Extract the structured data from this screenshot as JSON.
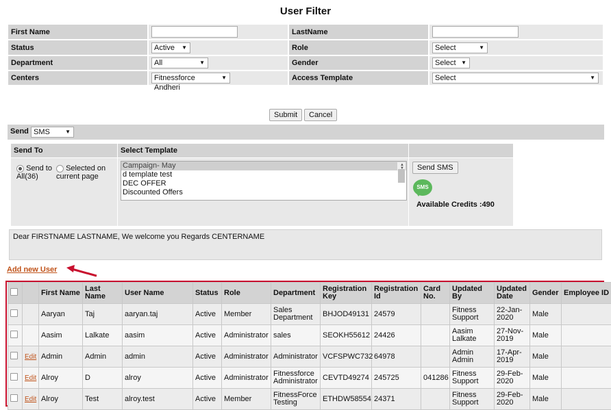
{
  "page_title": "User Filter",
  "filter": {
    "first_name_label": "First Name",
    "last_name_label": "LastName",
    "first_name_value": "",
    "last_name_value": "",
    "status_label": "Status",
    "status_value": "Active",
    "role_label": "Role",
    "role_value": "Select",
    "department_label": "Department",
    "department_value": "All",
    "gender_label": "Gender",
    "gender_value": "Select",
    "centers_label": "Centers",
    "centers_value": "Fitnessforce Andheri",
    "access_template_label": "Access Template",
    "access_template_value": "Select",
    "submit_label": "Submit",
    "cancel_label": "Cancel"
  },
  "send": {
    "label": "Send",
    "mode": "SMS",
    "send_to_header": "Send To",
    "select_template_header": "Select Template",
    "option_all": "Send to All(36)",
    "option_all_a": "Send to",
    "option_all_b": "All(36)",
    "option_page_a": "Selected on",
    "option_page_b": "current page",
    "templates": [
      "Campaign- May",
      "d template test",
      "DEC OFFER",
      "Discounted Offers"
    ],
    "send_sms_label": "Send SMS",
    "sms_icon_text": "SMS",
    "credits": "Available Credits :490",
    "message": "Dear FIRSTNAME LASTNAME, We welcome you Regards CENTERNAME"
  },
  "add_new_user_label": "Add new User",
  "table": {
    "headers": [
      "",
      "",
      "First Name",
      "Last Name",
      "User Name",
      "Status",
      "Role",
      "Department",
      "Registration Key",
      "Registration Id",
      "Card No.",
      "Updated By",
      "Updated Date",
      "Gender",
      "Employee ID"
    ],
    "edit_label": "Edit",
    "rows": [
      {
        "edit": false,
        "first": "Aaryan",
        "last": "Taj",
        "user": "aaryan.taj",
        "status": "Active",
        "role": "Member",
        "dept": "Sales Department",
        "key": "BHJOD49131",
        "regid": "24579",
        "card": "",
        "by": "Fitness Support",
        "date": "22-Jan-2020",
        "gender": "Male",
        "emp": ""
      },
      {
        "edit": false,
        "first": "Aasim",
        "last": "Lalkate",
        "user": "aasim",
        "status": "Active",
        "role": "Administrator",
        "dept": "sales",
        "key": "SEOKH55612",
        "regid": "24426",
        "card": "",
        "by": "Aasim Lalkate",
        "date": "27-Nov-2019",
        "gender": "Male",
        "emp": ""
      },
      {
        "edit": true,
        "first": "Admin",
        "last": "Admin",
        "user": "admin",
        "status": "Active",
        "role": "Administrator",
        "dept": "Administrator",
        "key": "VCFSPWC732",
        "regid": "64978",
        "card": "",
        "by": "Admin Admin",
        "date": "17-Apr-2019",
        "gender": "Male",
        "emp": ""
      },
      {
        "edit": true,
        "first": "Alroy",
        "last": "D",
        "user": "alroy",
        "status": "Active",
        "role": "Administrator",
        "dept": "Fitnessforce Administrator",
        "key": "CEVTD49274",
        "regid": "245725",
        "card": "041286",
        "by": "Fitness Support",
        "date": "29-Feb-2020",
        "gender": "Male",
        "emp": ""
      },
      {
        "edit": true,
        "first": "Alroy",
        "last": "Test",
        "user": "alroy.test",
        "status": "Active",
        "role": "Member",
        "dept": "FitnessForce Testing",
        "key": "ETHDW58554",
        "regid": "24371",
        "card": "",
        "by": "Fitness Support",
        "date": "29-Feb-2020",
        "gender": "Male",
        "emp": ""
      }
    ]
  },
  "colors": {
    "highlight_border": "#c8102e",
    "link": "#c0531a",
    "sms_green": "#5cb85c",
    "arrow": "#c8102e"
  }
}
